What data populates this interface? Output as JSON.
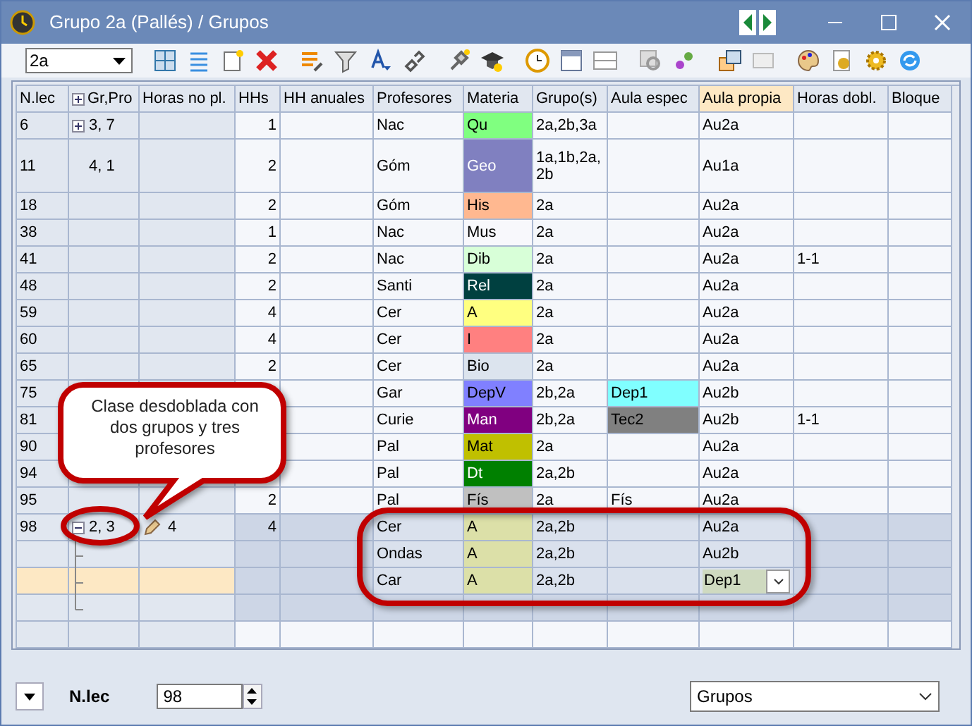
{
  "window": {
    "title": "Grupo 2a (Pallés) / Grupos"
  },
  "toolbar": {
    "class_selector": "2a"
  },
  "table": {
    "columns": [
      {
        "label": "N.lec",
        "selected": false
      },
      {
        "label": "Gr,Pro",
        "selected": false
      },
      {
        "label": "Horas no pl.",
        "selected": false
      },
      {
        "label": "HHs",
        "selected": false
      },
      {
        "label": "HH anuales",
        "selected": false
      },
      {
        "label": "Profesores",
        "selected": false
      },
      {
        "label": "Materia",
        "selected": false
      },
      {
        "label": "Grupo(s)",
        "selected": false
      },
      {
        "label": "Aula espec",
        "selected": false
      },
      {
        "label": "Aula propia",
        "selected": true
      },
      {
        "label": "Horas dobl.",
        "selected": false
      },
      {
        "label": "Bloque",
        "selected": false
      }
    ],
    "rows": [
      {
        "kind": "lesson",
        "selected": false,
        "expanded": false,
        "n_lec": "6",
        "gr_pro": "3, 7",
        "hhs": "1",
        "profesores": "Nac",
        "materia": {
          "text": "Qu",
          "color": "#80ff80"
        },
        "grupos": "2a,2b,3a",
        "aula_propia": "Au2a"
      },
      {
        "kind": "tall",
        "selected": false,
        "n_lec": "11",
        "gr_pro": "4, 1",
        "hhs": "2",
        "profesores": "Góm",
        "materia": {
          "text": "Geo",
          "color": "#8080c0"
        },
        "grupos": "1a,1b,2a,2b",
        "aula_propia": "Au1a"
      },
      {
        "kind": "lesson",
        "selected": false,
        "n_lec": "18",
        "hhs": "2",
        "profesores": "Góm",
        "materia": {
          "text": "His",
          "color": "#ffb890"
        },
        "grupos": "2a",
        "aula_propia": "Au2a"
      },
      {
        "kind": "lesson",
        "selected": false,
        "n_lec": "38",
        "hhs": "1",
        "profesores": "Nac",
        "materia": {
          "text": "Mus",
          "color": "#f8f8fc"
        },
        "grupos": "2a",
        "aula_propia": "Au2a"
      },
      {
        "kind": "lesson",
        "selected": false,
        "n_lec": "41",
        "hhs": "2",
        "profesores": "Nac",
        "materia": {
          "text": "Dib",
          "color": "#d8ffd8"
        },
        "grupos": "2a",
        "aula_propia": "Au2a",
        "horas_dobl": "1-1"
      },
      {
        "kind": "lesson",
        "selected": false,
        "n_lec": "48",
        "hhs": "2",
        "profesores": "Santi",
        "materia": {
          "text": "Rel",
          "color": "#004040"
        },
        "grupos": "2a",
        "aula_propia": "Au2a"
      },
      {
        "kind": "lesson",
        "selected": false,
        "n_lec": "59",
        "hhs": "4",
        "profesores": "Cer",
        "materia": {
          "text": "A",
          "color": "#ffff80"
        },
        "grupos": "2a",
        "aula_propia": "Au2a"
      },
      {
        "kind": "lesson",
        "selected": false,
        "n_lec": "60",
        "hhs": "4",
        "profesores": "Cer",
        "materia": {
          "text": "I",
          "color": "#ff8080"
        },
        "grupos": "2a",
        "aula_propia": "Au2a"
      },
      {
        "kind": "lesson",
        "selected": false,
        "n_lec": "65",
        "hhs": "2",
        "profesores": "Cer",
        "materia": {
          "text": "Bio",
          "color": "#dce4ee"
        },
        "grupos": "2a",
        "aula_propia": "Au2a"
      },
      {
        "kind": "lesson",
        "selected": false,
        "n_lec": "75",
        "profesores": "Gar",
        "materia": {
          "text": "DepV",
          "color": "#8080ff"
        },
        "grupos": "2b,2a",
        "aula_espec": {
          "text": "Dep1",
          "color": "#80ffff"
        },
        "aula_propia": "Au2b"
      },
      {
        "kind": "lesson",
        "selected": false,
        "n_lec": "81",
        "profesores": "Curie",
        "materia": {
          "text": "Man",
          "color": "#800080"
        },
        "grupos": "2b,2a",
        "aula_espec": {
          "text": "Tec2",
          "color": "#808080"
        },
        "aula_propia": "Au2b",
        "horas_dobl": "1-1"
      },
      {
        "kind": "lesson",
        "selected": false,
        "n_lec": "90",
        "profesores": "Pal",
        "materia": {
          "text": "Mat",
          "color": "#c0c000"
        },
        "grupos": "2a",
        "aula_propia": "Au2a"
      },
      {
        "kind": "lesson",
        "selected": false,
        "n_lec": "94",
        "profesores": "Pal",
        "materia": {
          "text": "Dt",
          "color": "#008000"
        },
        "grupos": "2a,2b",
        "aula_propia": "Au2a"
      },
      {
        "kind": "lesson",
        "selected": false,
        "n_lec": "95",
        "hhs": "2",
        "profesores": "Pal",
        "materia": {
          "text": "Fís",
          "color": "#c0c0c0"
        },
        "grupos": "2a",
        "aula_espec": {
          "text": "Fís"
        },
        "aula_propia": "Au2a"
      },
      {
        "kind": "group",
        "selected": false,
        "expanded": true,
        "n_lec": "98",
        "gr_pro": "2, 3",
        "horas_no_pl": "4",
        "hhs": "4",
        "profesores": "Cer",
        "materia": {
          "text": "A",
          "color": "#dce0a8"
        },
        "grupos": "2a,2b",
        "aula_propia": "Au2a"
      },
      {
        "kind": "sub",
        "selected": false,
        "profesores": "Ondas",
        "materia": {
          "text": "A",
          "color": "#dce0a8"
        },
        "grupos": "2a,2b",
        "aula_propia": "Au2b"
      },
      {
        "kind": "sub",
        "selected": true,
        "profesores": "Car",
        "materia": {
          "text": "A",
          "color": "#dce0a8"
        },
        "grupos": "2a,2b",
        "aula_propia": "Dep1",
        "aula_propia_dropdown": true
      },
      {
        "kind": "sub",
        "selected": false
      },
      {
        "kind": "empty",
        "selected": false
      }
    ]
  },
  "callout": {
    "text": "Clase desdoblada con dos grupos y tres profesores"
  },
  "status_bar": {
    "field_label": "N.lec",
    "field_value": "98",
    "view_select": "Grupos"
  }
}
